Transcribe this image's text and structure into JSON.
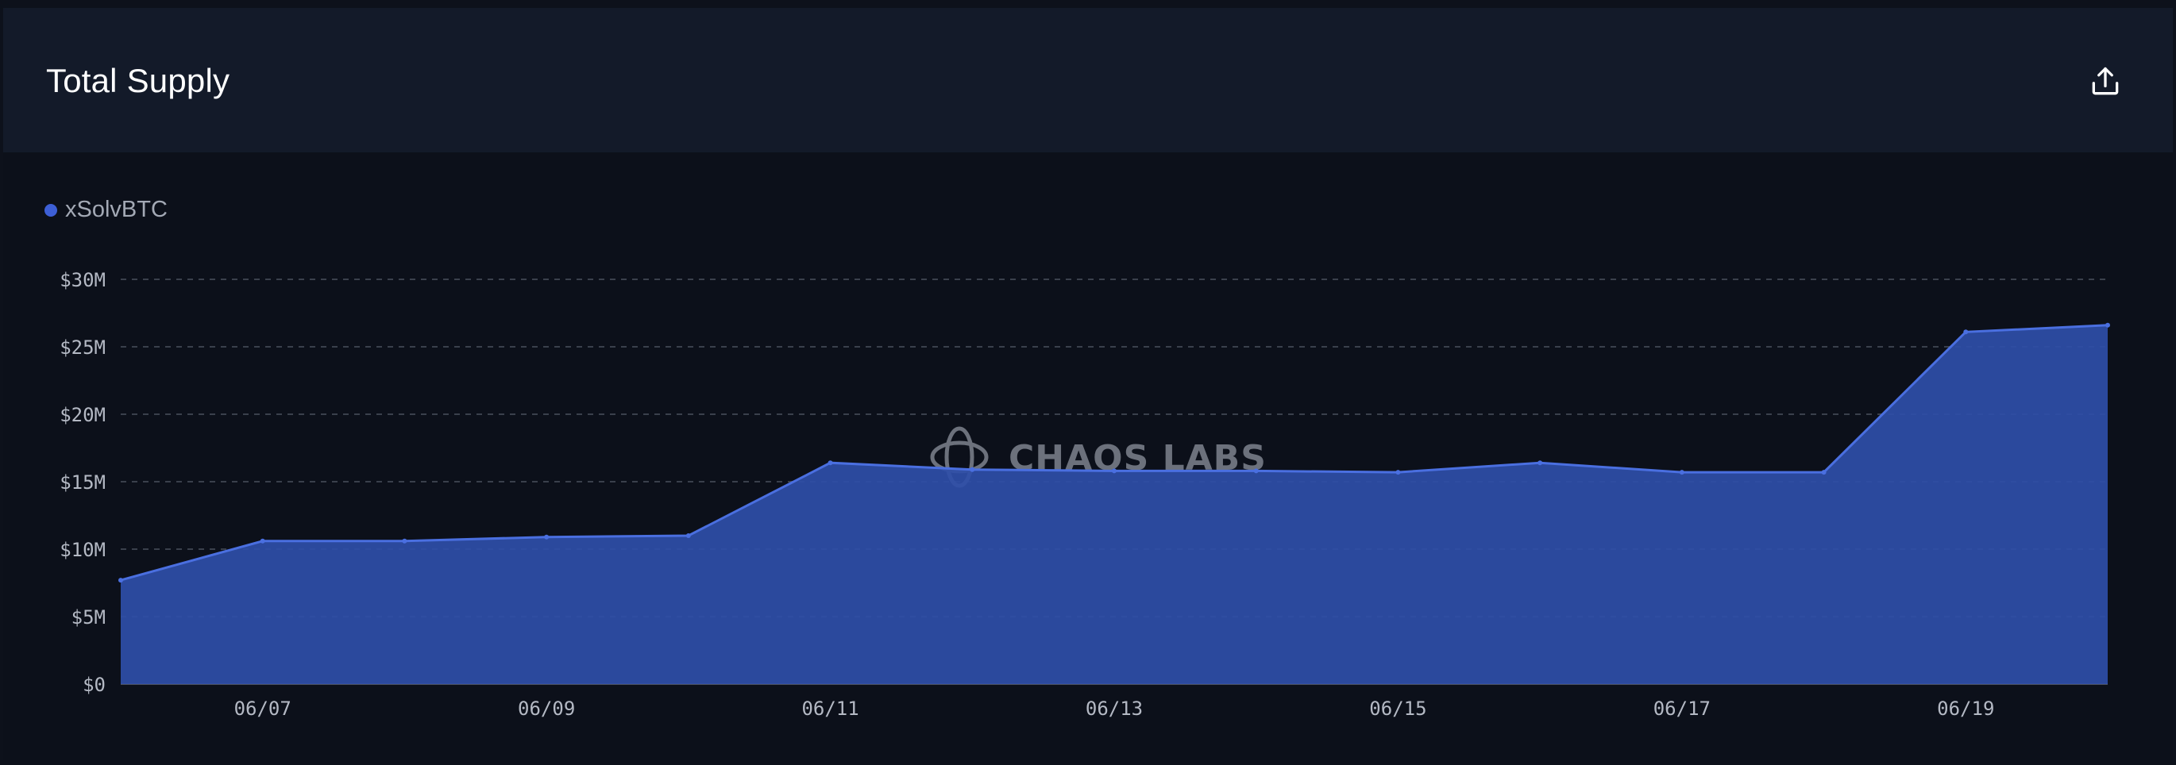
{
  "panel": {
    "title": "Total Supply",
    "export_icon": "share-upload-icon",
    "watermark": "CHAOS LABS",
    "watermark_icon": "chaos-labs-logo-icon"
  },
  "colors": {
    "series": "#3d5fd6",
    "area_fill": "#2f4ea8",
    "line": "#4a6fe0",
    "grid": "#3a404c",
    "tick": "#b4b9c4"
  },
  "chart_data": {
    "type": "area",
    "title": "Total Supply",
    "xlabel": "",
    "ylabel": "",
    "x": [
      "06/06",
      "06/07",
      "06/08",
      "06/09",
      "06/10",
      "06/11",
      "06/12",
      "06/13",
      "06/14",
      "06/15",
      "06/16",
      "06/17",
      "06/18",
      "06/19",
      "06/20"
    ],
    "x_ticks": [
      "06/07",
      "06/09",
      "06/11",
      "06/13",
      "06/15",
      "06/17",
      "06/19"
    ],
    "series": [
      {
        "name": "xSolvBTC",
        "values": [
          7.7,
          10.6,
          10.6,
          10.9,
          11.0,
          16.4,
          15.9,
          15.8,
          15.8,
          15.7,
          16.4,
          15.7,
          15.7,
          26.1,
          26.6
        ]
      }
    ],
    "ylim": [
      0,
      30
    ],
    "y_ticks": [
      0,
      5,
      10,
      15,
      20,
      25,
      30
    ],
    "y_tick_labels": [
      "$0",
      "$5M",
      "$10M",
      "$15M",
      "$20M",
      "$25M",
      "$30M"
    ],
    "grid": true,
    "legend": "top-left"
  }
}
